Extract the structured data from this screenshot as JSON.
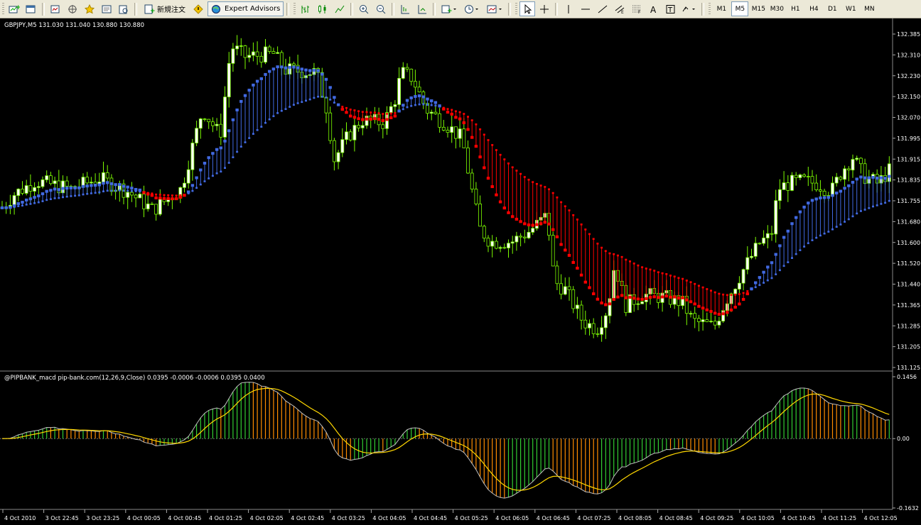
{
  "toolbar": {
    "new_order_label": "新規注文",
    "expert_advisors_label": "Expert Advisors",
    "timeframes": [
      "M1",
      "M5",
      "M15",
      "M30",
      "H1",
      "H4",
      "D1",
      "W1",
      "MN"
    ],
    "active_timeframe": "M5"
  },
  "price_chart": {
    "header": "GBPJPY,M5  131.030 131.040 130.880 130.880",
    "ticks": [
      "132.385",
      "132.310",
      "132.230",
      "132.150",
      "132.070",
      "131.995",
      "131.915",
      "131.835",
      "131.755",
      "131.680",
      "131.600",
      "131.520",
      "131.440",
      "131.365",
      "131.285",
      "131.205",
      "131.125"
    ],
    "price_max": 132.385,
    "price_min": 131.125,
    "colors": {
      "bull": "#7cfc00",
      "bear_body": "#000000",
      "bull_body": "#ffffff",
      "ma_up": "#4169e1",
      "ma_down": "#ff0000"
    }
  },
  "macd_panel": {
    "header": "@PIPBANK_macd pip-bank.com(12,26,9,Close)  0.0395 -0.0006 -0.0006 0.0395 0.0400",
    "ticks": {
      "top": "0.1456",
      "mid": "0.00",
      "bottom": "-0.1632"
    },
    "range": [
      -0.1632,
      0.1456
    ],
    "colors": {
      "pos_rising": "#32cd32",
      "neg_falling": "#ff8c00",
      "signal": "#ffd700",
      "macd": "#c0c0c0"
    }
  },
  "time_axis": [
    "4 Oct 2010",
    "3 Oct 22:45",
    "3 Oct 23:25",
    "4 Oct 00:05",
    "4 Oct 00:45",
    "4 Oct 01:25",
    "4 Oct 02:05",
    "4 Oct 02:45",
    "4 Oct 03:25",
    "4 Oct 04:05",
    "4 Oct 04:45",
    "4 Oct 05:25",
    "4 Oct 06:05",
    "4 Oct 06:45",
    "4 Oct 07:25",
    "4 Oct 08:05",
    "4 Oct 08:45",
    "4 Oct 09:25",
    "4 Oct 10:05",
    "4 Oct 10:45",
    "4 Oct 11:25",
    "4 Oct 12:05"
  ]
}
